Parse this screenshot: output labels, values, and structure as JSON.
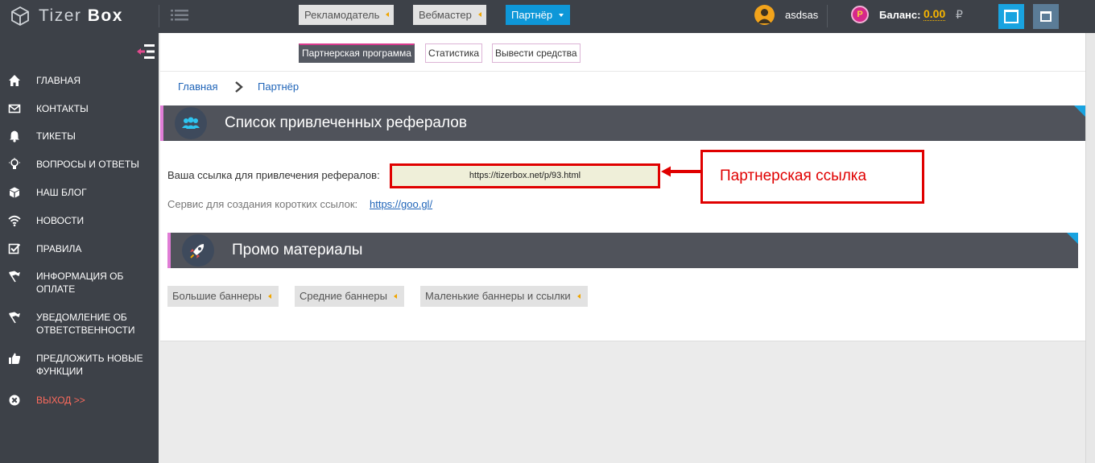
{
  "app": {
    "logo_brand_first": "Tizer",
    "logo_brand_second": "Box"
  },
  "topbar": {
    "role_buttons": [
      {
        "label": "Рекламодатель"
      },
      {
        "label": "Вебмастер"
      },
      {
        "label": "Партнёр",
        "active": true
      }
    ],
    "username": "asdsas",
    "coin_symbol": "P",
    "balance_label": "Баланс:",
    "balance_value": "0.00",
    "currency_symbol": "₽"
  },
  "sidebar": {
    "items": [
      {
        "label": "Главная",
        "icon": "home-icon"
      },
      {
        "label": "Контакты",
        "icon": "envelope-icon"
      },
      {
        "label": "Тикеты",
        "icon": "bell-icon"
      },
      {
        "label": "Вопросы и ответы",
        "icon": "lightbulb-icon"
      },
      {
        "label": "Наш блог",
        "icon": "cube-icon"
      },
      {
        "label": "Новости",
        "icon": "wifi-icon"
      },
      {
        "label": "Правила",
        "icon": "checkbox-icon"
      },
      {
        "label": "Информация об оплате",
        "icon": "flag-icon"
      },
      {
        "label": "Уведомление об ответственности",
        "icon": "flag-icon"
      },
      {
        "label": "Предложить новые функции",
        "icon": "thumbs-up-icon"
      },
      {
        "label": "Выход >>",
        "icon": "close-circle-icon"
      }
    ]
  },
  "tabs": [
    {
      "label": "Партнерская программа",
      "active": true
    },
    {
      "label": "Статистика"
    },
    {
      "label": "Вывести средства"
    }
  ],
  "breadcrumb": {
    "items": [
      "Главная",
      "Партнёр"
    ]
  },
  "referrals": {
    "title": "Список привлеченных рефералов",
    "link_label": "Ваша ссылка для привлечения рефералов:",
    "link_value": "https://tizerbox.net/p/93.html",
    "short_service_label": "Сервис для создания коротких ссылок:",
    "short_service_link": "https://goo.gl/"
  },
  "callout": {
    "text": "Партнерская ссылка",
    "color": "#e00000"
  },
  "promo": {
    "title": "Промо материалы",
    "buttons": [
      {
        "label": "Большие баннеры"
      },
      {
        "label": "Средние баннеры"
      },
      {
        "label": "Маленькие баннеры и ссылки"
      }
    ]
  },
  "colors": {
    "sidebar_bg": "#3d4148",
    "accent_blue": "#0e97d8",
    "balance": "#f7b500",
    "section_bar": "#50535b",
    "exit": "#ff6b5d"
  }
}
